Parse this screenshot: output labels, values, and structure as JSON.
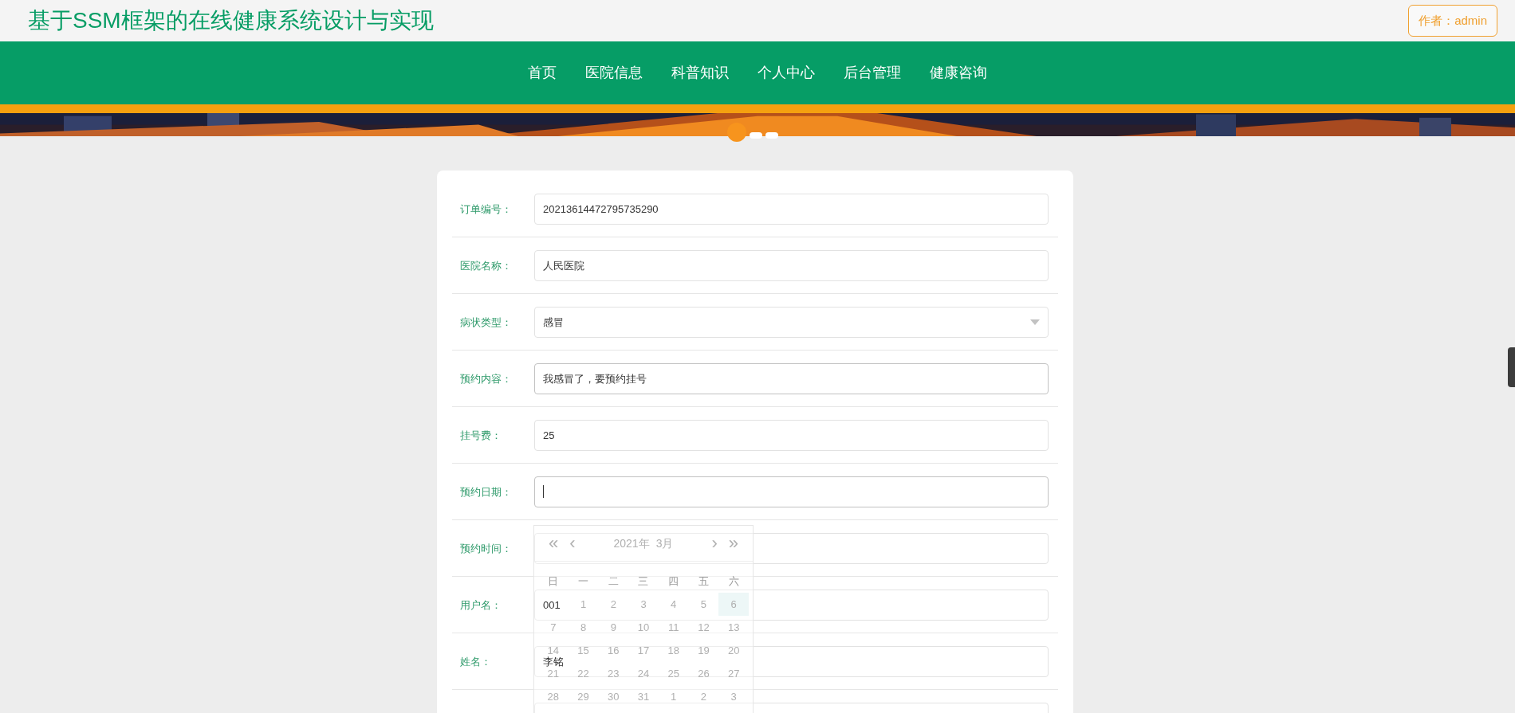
{
  "header": {
    "title": "基于SSM框架的在线健康系统设计与实现",
    "author_button": "作者：admin"
  },
  "nav": [
    {
      "label": "首页"
    },
    {
      "label": "医院信息"
    },
    {
      "label": "科普知识"
    },
    {
      "label": "个人中心"
    },
    {
      "label": "后台管理"
    },
    {
      "label": "健康咨询"
    }
  ],
  "banner": {
    "kind": "picture",
    "dots": [
      {
        "selected": true
      },
      {
        "selected": false
      },
      {
        "selected": false
      }
    ]
  },
  "form": {
    "fields": [
      {
        "label": "订单编号：",
        "kind": "text",
        "value": "20213614472795735290"
      },
      {
        "label": "医院名称：",
        "kind": "text",
        "value": "人民医院"
      },
      {
        "label": "病状类型：",
        "kind": "select",
        "value": "感冒"
      },
      {
        "label": "预约内容：",
        "kind": "text",
        "value": "我感冒了，要预约挂号",
        "focused": true
      },
      {
        "label": "挂号费：",
        "kind": "text",
        "value": "25"
      },
      {
        "label": "预约日期：",
        "kind": "text",
        "focused": true
      },
      {
        "label": "预约时间：",
        "kind": "text"
      },
      {
        "label": "用户名：",
        "kind": "text",
        "value": "001"
      },
      {
        "label": "姓名：",
        "kind": "text",
        "value": "李铭"
      },
      {
        "kind": "text"
      }
    ]
  },
  "date_picker": {
    "prev_year": "«",
    "prev_month": "‹",
    "year": "2021年",
    "month": "3月",
    "next_month": "›",
    "next_year": "»",
    "weekdays": [
      "日",
      "一",
      "二",
      "三",
      "四",
      "五",
      "六"
    ],
    "weeks": [
      [
        {
          "day": "1",
          "selected": false
        },
        {
          "day": "2",
          "selected": false
        },
        {
          "day": "3",
          "selected": false
        },
        {
          "day": "4",
          "selected": false
        },
        {
          "day": "5",
          "selected": false
        },
        {
          "day": "6",
          "selected": true
        }
      ],
      [
        {
          "day": "7",
          "selected": false
        },
        {
          "day": "8",
          "selected": false
        },
        {
          "day": "9",
          "selected": false
        },
        {
          "day": "10",
          "selected": false
        },
        {
          "day": "11",
          "selected": false
        },
        {
          "day": "12",
          "selected": false
        },
        {
          "day": "13",
          "selected": false
        }
      ],
      [
        {
          "day": "14",
          "selected": false
        },
        {
          "day": "15",
          "selected": false
        },
        {
          "day": "16",
          "selected": false
        },
        {
          "day": "17",
          "selected": false
        },
        {
          "day": "18",
          "selected": false
        },
        {
          "day": "19",
          "selected": false
        },
        {
          "day": "20",
          "selected": false
        }
      ],
      [
        {
          "day": "21",
          "selected": false
        },
        {
          "day": "22",
          "selected": false
        },
        {
          "day": "23",
          "selected": false
        },
        {
          "day": "24",
          "selected": false
        },
        {
          "day": "25",
          "selected": false
        },
        {
          "day": "26",
          "selected": false
        },
        {
          "day": "27",
          "selected": false
        }
      ],
      [
        {
          "day": "28",
          "selected": false
        },
        {
          "day": "29",
          "selected": false
        },
        {
          "day": "30",
          "selected": false
        },
        {
          "day": "31",
          "selected": false
        },
        {
          "day": "1",
          "selected": false
        },
        {
          "day": "2",
          "selected": false
        },
        {
          "day": "3",
          "selected": false
        }
      ]
    ]
  }
}
